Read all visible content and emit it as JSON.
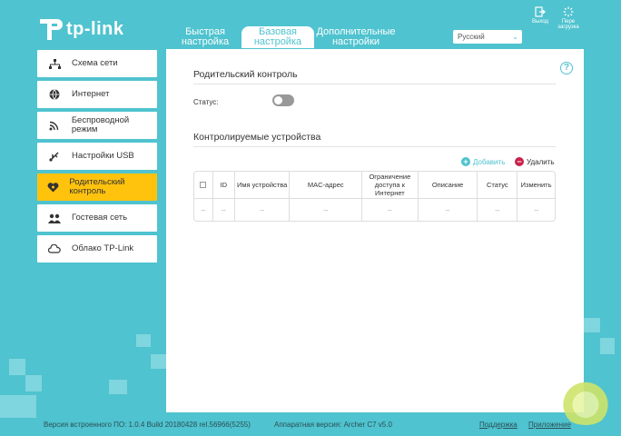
{
  "brand": {
    "logo_text": "tp-link"
  },
  "tabs": [
    {
      "label": "Быстрая настройка",
      "active": false
    },
    {
      "label": "Базовая настройка",
      "active": true
    },
    {
      "label": "Дополнительные настройки",
      "active": false
    }
  ],
  "language": {
    "selected": "Русский"
  },
  "header_buttons": {
    "logout": "Выход",
    "reboot": "Пере загрузка"
  },
  "sidebar": {
    "items": [
      {
        "label": "Схема сети",
        "icon": "network-map-icon"
      },
      {
        "label": "Интернет",
        "icon": "globe-icon"
      },
      {
        "label": "Беспроводной режим",
        "icon": "wifi-icon"
      },
      {
        "label": "Настройки USB",
        "icon": "usb-icon"
      },
      {
        "label": "Родительский контроль",
        "icon": "heart-icon",
        "active": true
      },
      {
        "label": "Гостевая сеть",
        "icon": "guests-icon"
      },
      {
        "label": "Облако TP-Link",
        "icon": "cloud-icon"
      }
    ]
  },
  "main": {
    "section1_title": "Родительский контроль",
    "status_label": "Статус:",
    "status_on": false,
    "section2_title": "Контролируемые устройства",
    "add_label": "Добавить",
    "delete_label": "Удалить",
    "table": {
      "headers": [
        "ID",
        "Имя устройства",
        "MAC-адрес",
        "Ограничение доступа к Интернет",
        "Описание",
        "Статус",
        "Изменить"
      ],
      "row": [
        "--",
        "--",
        "--",
        "--",
        "--",
        "--",
        "--",
        "--"
      ]
    }
  },
  "footer": {
    "firmware": "Версия встроенного ПО: 1.0.4 Build 20180428 rel.56966(5255)",
    "hardware": "Аппаратная версия: Archer C7 v5.0",
    "support": "Поддержка",
    "app": "Приложение"
  },
  "colors": {
    "accent": "#4fc3cf",
    "active_side": "#ffc30e",
    "delete": "#c8224a"
  }
}
